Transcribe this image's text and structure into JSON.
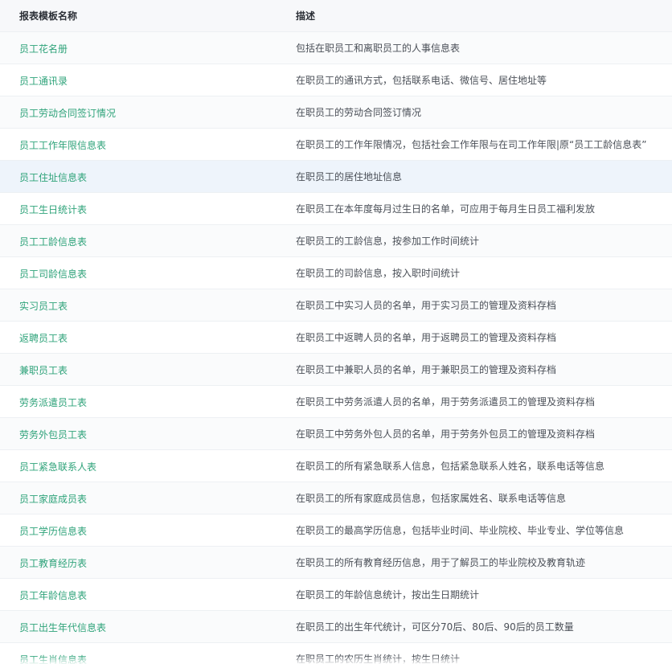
{
  "table": {
    "columns": {
      "name": "报表模板名称",
      "description": "描述"
    },
    "highlighted_index": 4,
    "rows": [
      {
        "name": "员工花名册",
        "description": "包括在职员工和离职员工的人事信息表"
      },
      {
        "name": "员工通讯录",
        "description": "在职员工的通讯方式，包括联系电话、微信号、居住地址等"
      },
      {
        "name": "员工劳动合同签订情况",
        "description": "在职员工的劳动合同签订情况"
      },
      {
        "name": "员工工作年限信息表",
        "description": "在职员工的工作年限情况，包括社会工作年限与在司工作年限|原“员工工龄信息表”"
      },
      {
        "name": "员工住址信息表",
        "description": "在职员工的居住地址信息"
      },
      {
        "name": "员工生日统计表",
        "description": "在职员工在本年度每月过生日的名单，可应用于每月生日员工福利发放"
      },
      {
        "name": "员工工龄信息表",
        "description": "在职员工的工龄信息，按参加工作时间统计"
      },
      {
        "name": "员工司龄信息表",
        "description": "在职员工的司龄信息，按入职时间统计"
      },
      {
        "name": "实习员工表",
        "description": "在职员工中实习人员的名单，用于实习员工的管理及资料存档"
      },
      {
        "name": "返聘员工表",
        "description": "在职员工中返聘人员的名单，用于返聘员工的管理及资料存档"
      },
      {
        "name": "兼职员工表",
        "description": "在职员工中兼职人员的名单，用于兼职员工的管理及资料存档"
      },
      {
        "name": "劳务派遣员工表",
        "description": "在职员工中劳务派遣人员的名单，用于劳务派遣员工的管理及资料存档"
      },
      {
        "name": "劳务外包员工表",
        "description": "在职员工中劳务外包人员的名单，用于劳务外包员工的管理及资料存档"
      },
      {
        "name": "员工紧急联系人表",
        "description": "在职员工的所有紧急联系人信息，包括紧急联系人姓名，联系电话等信息"
      },
      {
        "name": "员工家庭成员表",
        "description": "在职员工的所有家庭成员信息，包括家属姓名、联系电话等信息"
      },
      {
        "name": "员工学历信息表",
        "description": "在职员工的最高学历信息，包括毕业时间、毕业院校、毕业专业、学位等信息"
      },
      {
        "name": "员工教育经历表",
        "description": "在职员工的所有教育经历信息，用于了解员工的毕业院校及教育轨迹"
      },
      {
        "name": "员工年龄信息表",
        "description": "在职员工的年龄信息统计，按出生日期统计"
      },
      {
        "name": "员工出生年代信息表",
        "description": "在职员工的出生年代统计，可区分70后、80后、90后的员工数量"
      },
      {
        "name": "员工生肖信息表",
        "description": "在职员工的农历生肖统计，按生日统计"
      }
    ]
  },
  "colors": {
    "link": "#2fa37a",
    "header_bg": "#f7f8fa",
    "highlight_bg": "#eef4fb"
  }
}
